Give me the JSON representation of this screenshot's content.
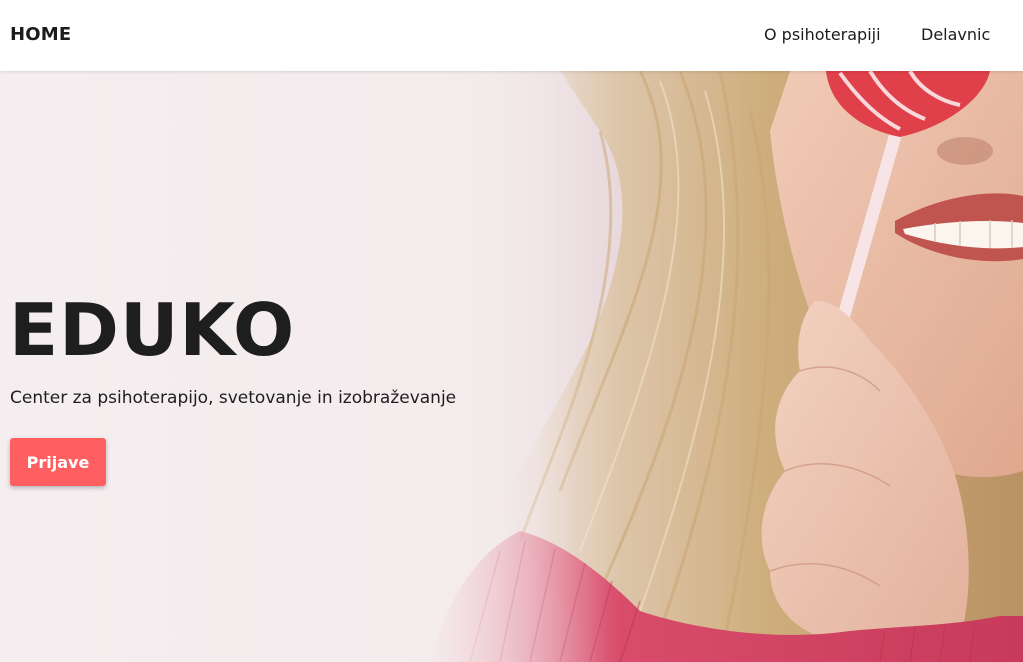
{
  "header": {
    "brand": "HOME",
    "nav": [
      {
        "label": "O psihoterapiji"
      },
      {
        "label": "Delavnic"
      }
    ]
  },
  "hero": {
    "title": "EDUKO",
    "subtitle": "Center za psihoterapijo, svetovanje in izobraževanje",
    "button_label": "Prijave",
    "image": "smiling blonde woman holding a red and white heart lollipop over her eye, pink ribbed sweater"
  },
  "colors": {
    "accent": "#ff5f60",
    "text": "#1e1e1e",
    "hero_background": "#f4eced",
    "navbar_background": "#ffffff"
  }
}
